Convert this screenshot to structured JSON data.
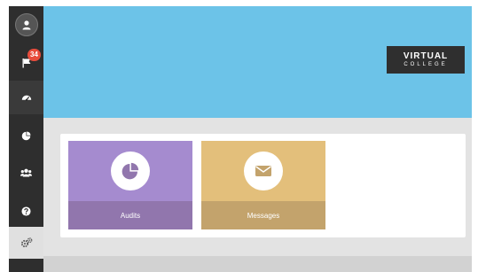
{
  "sidebar": {
    "notification_count": "34",
    "items": [
      {
        "icon": "user-icon"
      },
      {
        "icon": "flag-icon"
      },
      {
        "icon": "dashboard-icon"
      },
      {
        "icon": "pie-chart-icon"
      },
      {
        "icon": "users-icon"
      },
      {
        "icon": "help-icon"
      },
      {
        "icon": "cogs-icon"
      }
    ]
  },
  "header": {
    "logo_line1": "VIRTUAL",
    "logo_line2": "COLLEGE"
  },
  "tiles": [
    {
      "label": "Audits",
      "icon": "pie-chart-icon",
      "color": "#a58bcf"
    },
    {
      "label": "Messages",
      "icon": "envelope-icon",
      "color": "#e3bf7b"
    }
  ],
  "colors": {
    "banner": "#6cc3e8",
    "sidebar": "#2e2e2e",
    "badge": "#e74c3c"
  }
}
